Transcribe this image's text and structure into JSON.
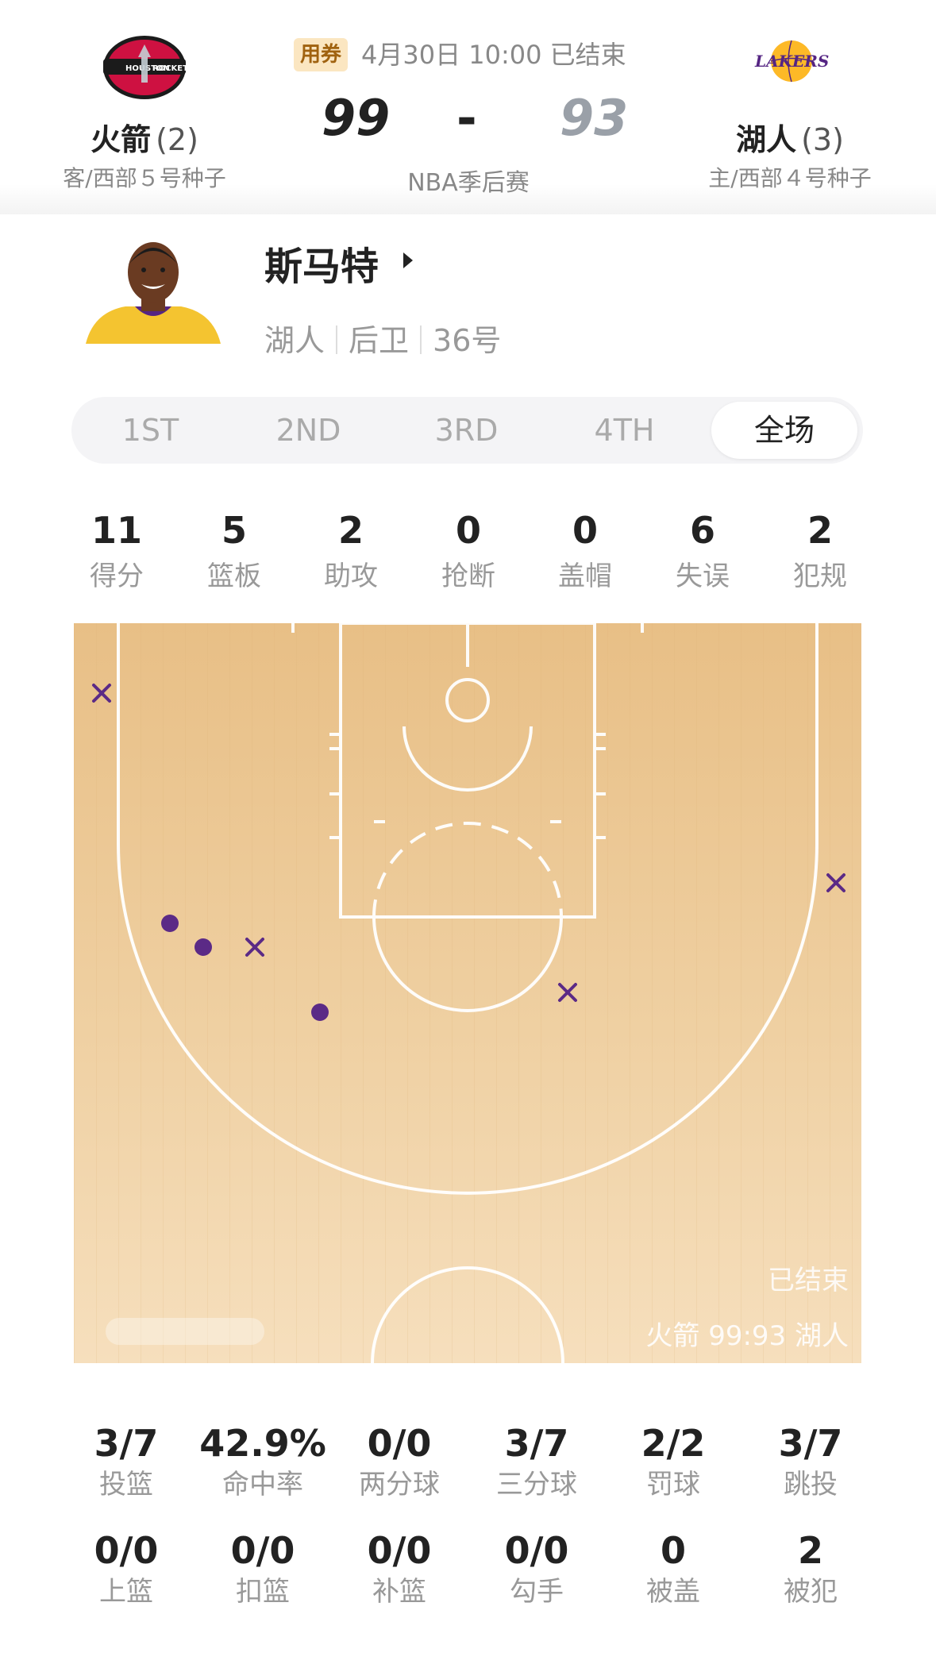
{
  "game": {
    "away": {
      "name": "火箭",
      "series_wins": "(2)",
      "seed": "客/西部５号种子",
      "score": "99",
      "logo_text": [
        "HOUSTON",
        "ROCKETS"
      ]
    },
    "home": {
      "name": "湖人",
      "series_wins": "(3)",
      "seed": "主/西部４号种子",
      "score": "93",
      "logo_text": "LAKERS"
    },
    "coupon": "用券",
    "datetime": "4月30日 10:00 已结束",
    "dash": "-",
    "type": "NBA季后赛"
  },
  "player": {
    "name": "斯马特",
    "team": "湖人",
    "position": "后卫",
    "number": "36号"
  },
  "tabs": [
    {
      "label": "1ST",
      "active": false
    },
    {
      "label": "2ND",
      "active": false
    },
    {
      "label": "3RD",
      "active": false
    },
    {
      "label": "4TH",
      "active": false
    },
    {
      "label": "全场",
      "active": true
    }
  ],
  "stats": [
    {
      "value": "11",
      "label": "得分"
    },
    {
      "value": "5",
      "label": "篮板"
    },
    {
      "value": "2",
      "label": "助攻"
    },
    {
      "value": "0",
      "label": "抢断"
    },
    {
      "value": "0",
      "label": "盖帽"
    },
    {
      "value": "6",
      "label": "失误"
    },
    {
      "value": "2",
      "label": "犯规"
    }
  ],
  "court": {
    "status": "已结束",
    "score_line": "火箭 99:93 湖人",
    "made_color": "#5b2a86",
    "missed_color": "#5b2a86",
    "shots": [
      {
        "result": "missed"
      },
      {
        "result": "missed"
      },
      {
        "result": "made"
      },
      {
        "result": "made"
      },
      {
        "result": "missed"
      },
      {
        "result": "missed"
      },
      {
        "result": "made"
      }
    ]
  },
  "shooting": [
    [
      {
        "value": "3/7",
        "label": "投篮"
      },
      {
        "value": "42.9%",
        "label": "命中率"
      },
      {
        "value": "0/0",
        "label": "两分球"
      },
      {
        "value": "3/7",
        "label": "三分球"
      },
      {
        "value": "2/2",
        "label": "罚球"
      },
      {
        "value": "3/7",
        "label": "跳投"
      }
    ],
    [
      {
        "value": "0/0",
        "label": "上篮"
      },
      {
        "value": "0/0",
        "label": "扣篮"
      },
      {
        "value": "0/0",
        "label": "补篮"
      },
      {
        "value": "0/0",
        "label": "勾手"
      },
      {
        "value": "0",
        "label": "被盖"
      },
      {
        "value": "2",
        "label": "被犯"
      }
    ]
  ],
  "colors": {
    "rockets_red": "#ce1141",
    "lakers_purple": "#552583",
    "lakers_gold": "#fdb927",
    "court_wood": "#e9c48f"
  }
}
